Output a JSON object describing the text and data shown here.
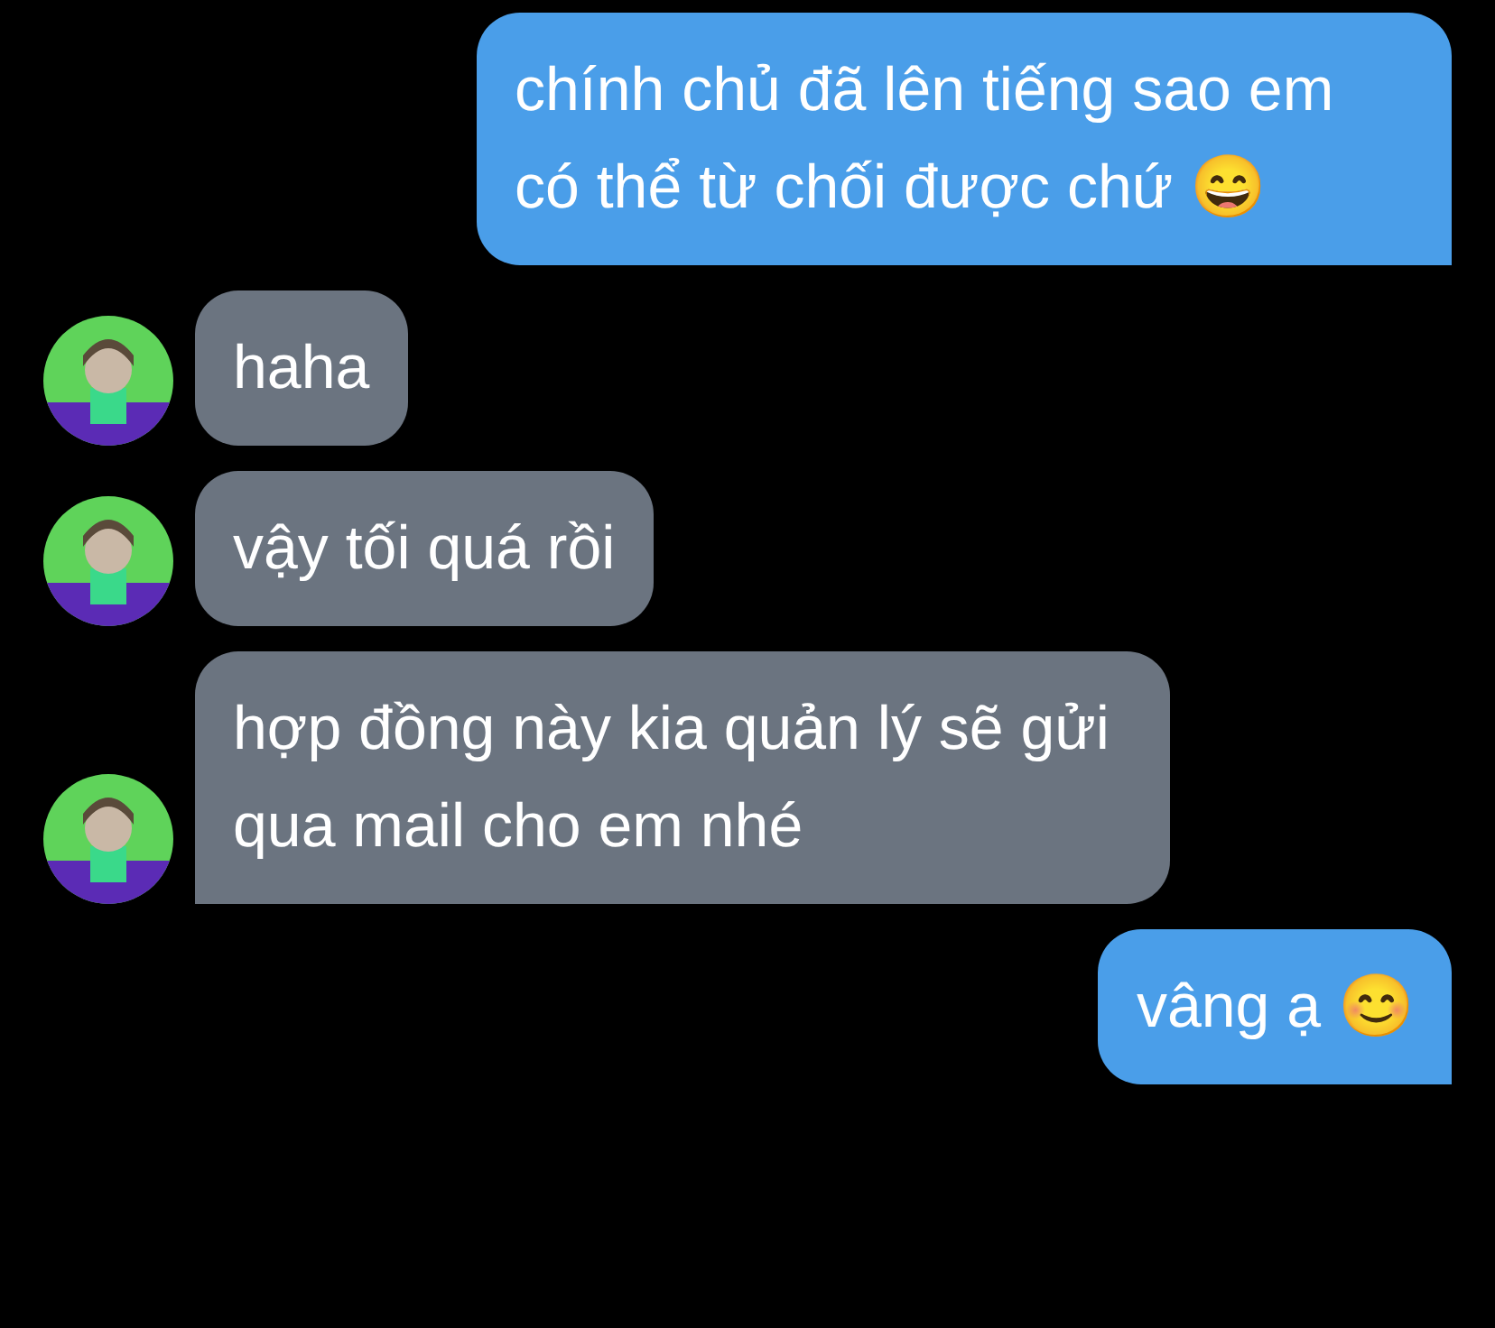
{
  "messages": [
    {
      "kind": "outgoing",
      "text": "chính chủ đã lên tiếng sao em có thể từ chối được chứ 😄"
    },
    {
      "kind": "incoming",
      "text": "haha"
    },
    {
      "kind": "incoming",
      "text": "vậy tối quá rồi"
    },
    {
      "kind": "incoming",
      "text": "hợp đồng này kia quản lý sẽ gửi qua mail cho em nhé"
    },
    {
      "kind": "outgoing",
      "text": "vâng ạ 😊"
    }
  ]
}
